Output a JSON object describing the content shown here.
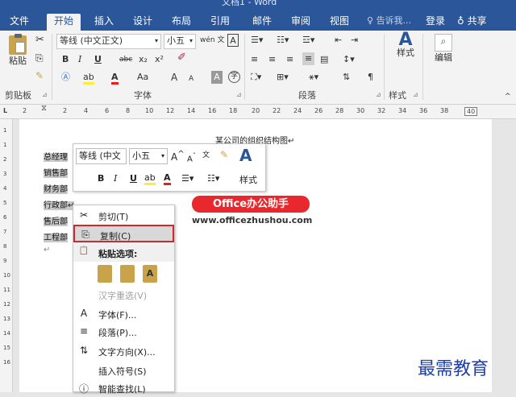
{
  "window": {
    "title": "文档1 - Word"
  },
  "tabs": [
    {
      "label": "文件",
      "active": false
    },
    {
      "label": "开始",
      "active": true
    },
    {
      "label": "插入",
      "active": false
    },
    {
      "label": "设计",
      "active": false
    },
    {
      "label": "布局",
      "active": false
    },
    {
      "label": "引用",
      "active": false
    },
    {
      "label": "邮件",
      "active": false
    },
    {
      "label": "审阅",
      "active": false
    },
    {
      "label": "视图",
      "active": false
    }
  ],
  "header": {
    "tell_me": "告诉我...",
    "login": "登录",
    "share": "共享"
  },
  "ribbon": {
    "clipboard": {
      "label": "剪贴板",
      "paste": "粘贴"
    },
    "font": {
      "label": "字体",
      "font_name": "等线 (中文正文)",
      "font_size": "小五",
      "bold": "B",
      "italic": "I",
      "underline": "U",
      "strike": "abc",
      "subscript": "x₂",
      "superscript": "x²",
      "font_color": "A",
      "case": "Aa",
      "grow": "A",
      "shrink": "A",
      "char_shade": "A",
      "enclose": "字",
      "wen": "wén 文",
      "char_border": "A"
    },
    "paragraph": {
      "label": "段落"
    },
    "styles": {
      "label": "样式",
      "button": "样式"
    },
    "editing": {
      "button": "编辑"
    }
  },
  "ruler": {
    "ticks": [
      "2",
      "2",
      "4",
      "6",
      "8",
      "10",
      "12",
      "14",
      "16",
      "18",
      "20",
      "22",
      "24",
      "26",
      "28",
      "30",
      "32",
      "34",
      "36",
      "38",
      "40"
    ]
  },
  "vruler": {
    "ticks": [
      "1",
      "1",
      "2",
      "3",
      "4",
      "5",
      "6",
      "7",
      "8",
      "9",
      "10",
      "11",
      "12",
      "13",
      "14",
      "15",
      "16"
    ]
  },
  "document": {
    "title": "某公司的组织结构图↵",
    "lines": [
      "总经理",
      "销售部",
      "财务部",
      "行政部↵",
      "售后部",
      "工程部"
    ],
    "empty_mark": "↵"
  },
  "mini_toolbar": {
    "font_name": "等线 (中文",
    "font_size": "小五",
    "styles": "样式",
    "bold": "B",
    "italic": "I",
    "underline": "U"
  },
  "context_menu": {
    "items": [
      {
        "label": "剪切(T)",
        "icon": "✂",
        "selected": false,
        "disabled": false
      },
      {
        "label": "复制(C)",
        "icon": "⎘",
        "selected": true,
        "disabled": false
      },
      {
        "label": "粘贴选项:",
        "icon": "📋",
        "selected": false,
        "disabled": false
      },
      {
        "label": "",
        "icon": "",
        "selected": false,
        "disabled": false
      },
      {
        "label": "汉字重选(V)",
        "icon": "",
        "selected": false,
        "disabled": true
      },
      {
        "label": "字体(F)...",
        "icon": "A",
        "selected": false,
        "disabled": false
      },
      {
        "label": "段落(P)...",
        "icon": "≡",
        "selected": false,
        "disabled": false
      },
      {
        "label": "文字方向(X)...",
        "icon": "⇅",
        "selected": false,
        "disabled": false
      },
      {
        "label": "插入符号(S)",
        "icon": "",
        "selected": false,
        "disabled": false
      },
      {
        "label": "智能查找(L)",
        "icon": "ⓘ",
        "selected": false,
        "disabled": false
      }
    ]
  },
  "watermark": {
    "logo_text": "Office办公助手",
    "url": "www.officezhushou.com",
    "corner": "最需教育"
  },
  "colors": {
    "accent": "#2b579a",
    "highlight_border": "#d6262b",
    "logo_red": "#e8282c",
    "corner_blue": "#1d3faa"
  }
}
